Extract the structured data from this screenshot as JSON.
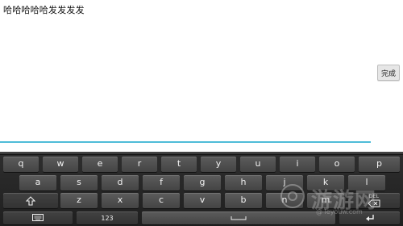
{
  "editor": {
    "typed_text": "哈哈哈哈哈发发发发",
    "done_label": "完成"
  },
  "keyboard": {
    "row1": [
      "q",
      "w",
      "e",
      "r",
      "t",
      "y",
      "u",
      "i",
      "o",
      "p"
    ],
    "row2": [
      "a",
      "s",
      "d",
      "f",
      "g",
      "h",
      "j",
      "k",
      "l"
    ],
    "row3": [
      "z",
      "x",
      "c",
      "v",
      "b",
      "n",
      "m"
    ],
    "del_label": "DEL",
    "numbers_label": "123",
    "icons": {
      "shift": "shift-arrow-icon",
      "backspace": "backspace-icon",
      "keyboard": "keyboard-icon",
      "space": "space-bar-icon",
      "enter": "enter-icon"
    }
  },
  "colors": {
    "text_underline": "#4fbcd8",
    "keyboard_bg": "#2a2a2a",
    "key_bg": "#4c4c4c"
  },
  "watermark": {
    "text": "游游网",
    "subtext": "@ leyouw.com"
  }
}
